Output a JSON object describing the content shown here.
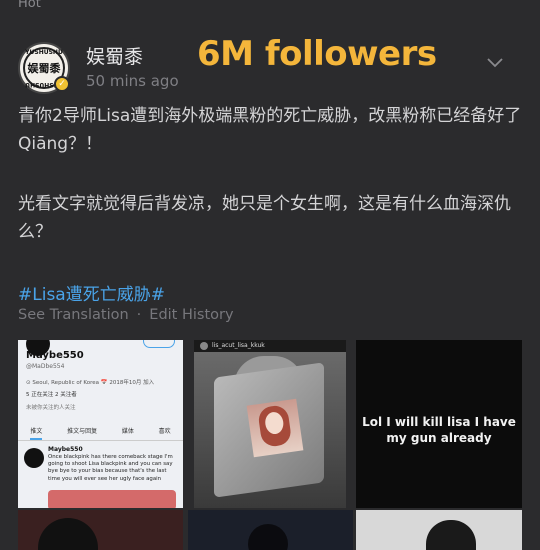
{
  "feed": {
    "section_label": "Hot"
  },
  "post": {
    "username": "娱蜀黍",
    "avatar_text": "娱蜀黍",
    "avatar_arc": "YUSHUSHU",
    "timestamp": "50  mins ago",
    "overlay_caption": "6M followers",
    "paragraph_1": "青你2导师Lisa遭到海外极端黑粉的死亡威胁，改黑粉称已经备好了Qiāng？！",
    "paragraph_2": "光看文字就觉得后背发凉，她只是个女生啊，这是有什么血海深仇么？",
    "hashtag": "#Lisa遭死亡威胁#",
    "see_translation": "See Translation",
    "action_separator": "·",
    "edit_history": "Edit History"
  },
  "images": {
    "tile1": {
      "name": "Maybe550",
      "handle": "@MaDbe554",
      "location": "⊙ Seoul, Republic of Korea  📅 2018年10月 加入",
      "stats": "5 正在关注   2 关注者",
      "note": "未被你关注的人关注",
      "tabs": [
        "推文",
        "推文与回复",
        "媒体",
        "喜欢"
      ],
      "post_name": "Maybe550",
      "post_text": "Once blackpink has there comeback stage I'm going to shoot Lisa blackpink and you can say bye bye to your bias because that's the last time you will ever see her ugly face again"
    },
    "tile2": {
      "handle": "lis_acut_lisa_kkuk"
    },
    "tile3": {
      "caption": "Lol I will kill lisa I have my gun already"
    }
  },
  "colors": {
    "background": "#2b2b2d",
    "overlay_caption": "#f4b63b",
    "hashtag": "#4aa3e8",
    "verified_badge": "#f1c232"
  },
  "icons": {
    "verified": "verified-badge-icon",
    "chevron": "chevron-down-icon"
  }
}
